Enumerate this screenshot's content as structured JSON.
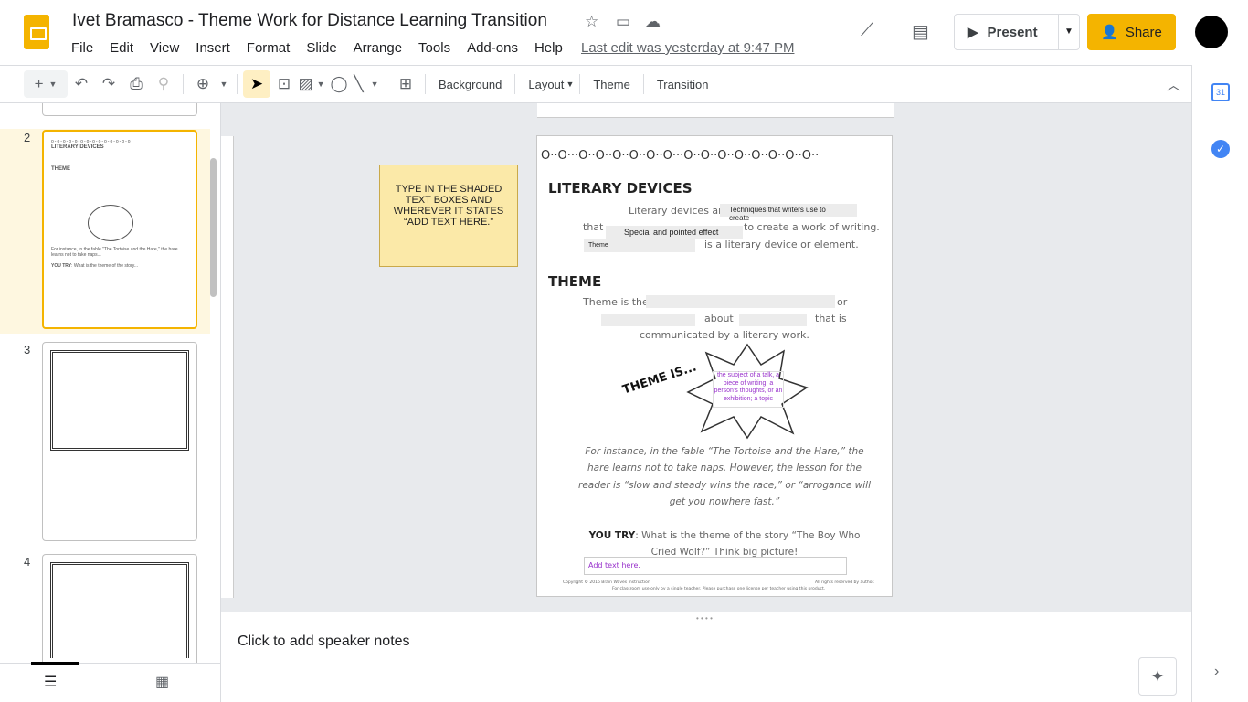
{
  "doc": {
    "title": "Ivet Bramasco - Theme Work for Distance Learning Transition",
    "last_edit": "Last edit was yesterday at 9:47 PM"
  },
  "menu": [
    "File",
    "Edit",
    "View",
    "Insert",
    "Format",
    "Slide",
    "Arrange",
    "Tools",
    "Add-ons",
    "Help"
  ],
  "header": {
    "present": "Present",
    "share": "Share"
  },
  "toolbar": {
    "background": "Background",
    "layout": "Layout",
    "theme": "Theme",
    "transition": "Transition"
  },
  "filmstrip": {
    "slides": [
      "2",
      "3",
      "4"
    ]
  },
  "note": "TYPE IN THE SHADED TEXT BOXES AND WHEREVER IT STATES “ADD TEXT HERE.”",
  "slide": {
    "h1": "LITERARY DEVICES",
    "ld_are": "Literary devices are",
    "ld_box1": "Techniques that writers use to create",
    "that": "that",
    "ld_box2": "Special and pointed effect",
    "create": "to create a work of writing.",
    "ld_box3": "Theme",
    "is_device": "is a literary device or element.",
    "h2": "THEME",
    "theme_is": "Theme is the",
    "or": "or",
    "about": "about",
    "that_is": "that is",
    "communicated": "communicated by a literary work.",
    "theme_is_burst": "THEME IS...",
    "definition": "the subject of a talk, a piece of writing, a person's thoughts, or an exhibition; a topic",
    "example": "For instance, in the fable “The Tortoise and the Hare,” the hare learns not to take naps.  However, the lesson for the reader is “slow and steady wins the race,” or “arrogance will get you nowhere fast.”",
    "you_try_label": "YOU TRY",
    "you_try": ":  What is the theme of the story “The Boy Who Cried Wolf?”  Think big picture!",
    "add_text": "Add text here.",
    "copyright": "Copyright © 2016 Brain Waves Instruction",
    "rights": "All rights reserved by author.",
    "license": "For classroom use only by a single teacher. Please purchase one license per teacher using this product."
  },
  "speaker_notes": "Click to add speaker notes",
  "colors": {
    "accent": "#f4b400",
    "selected_tool": "#feefc3",
    "purple": "#9933cc"
  }
}
